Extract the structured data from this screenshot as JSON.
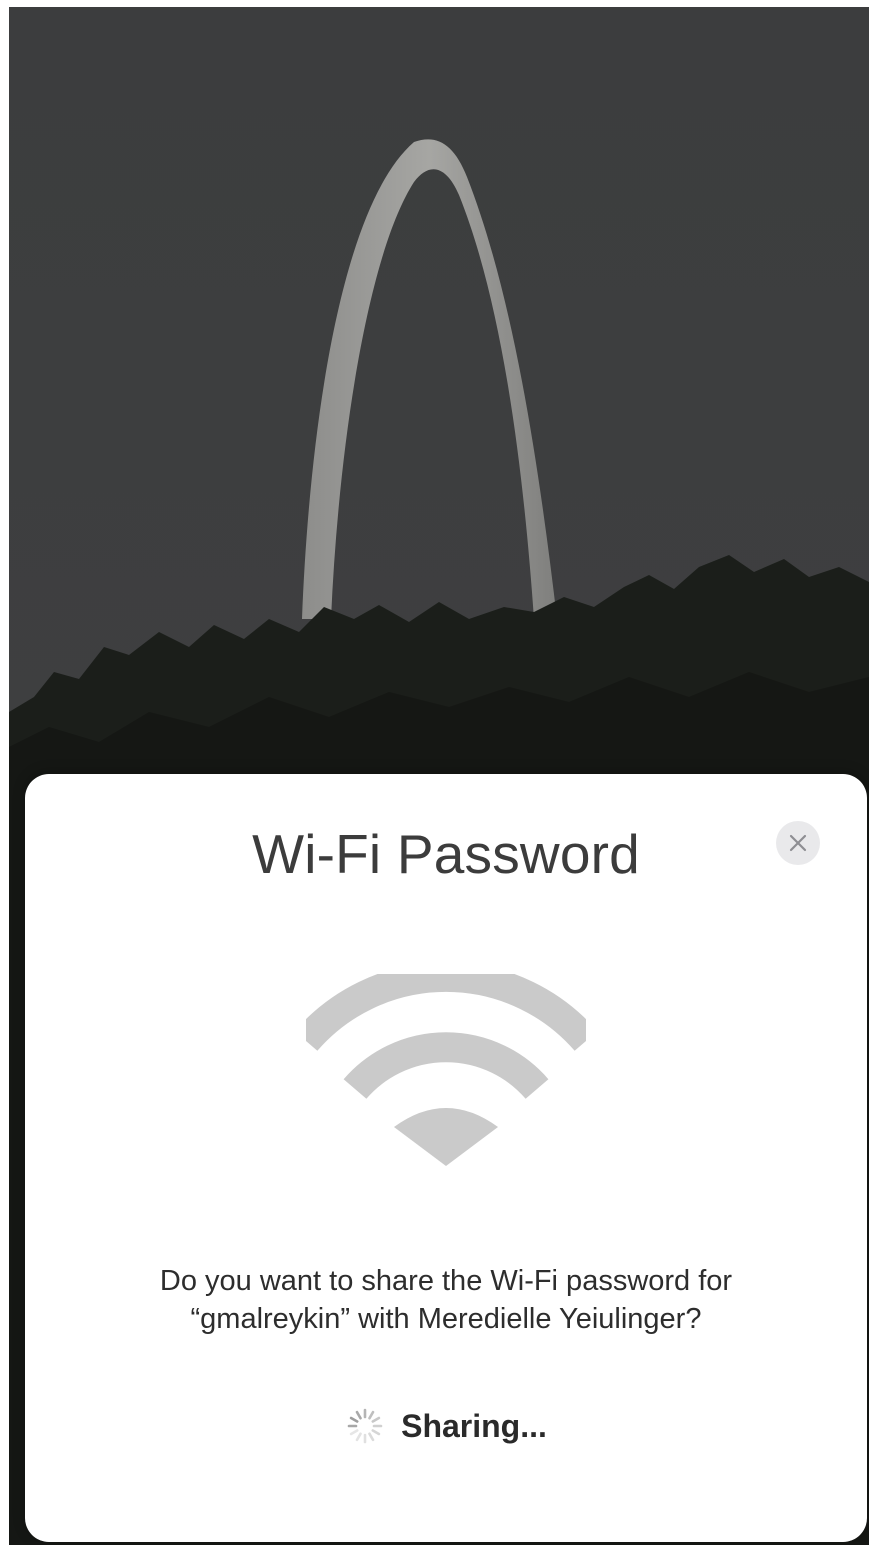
{
  "dialog": {
    "title": "Wi-Fi Password",
    "message_line1": "Do you want to share the Wi-Fi password for",
    "message_line2": "“gmalreykin” with Meredielle Yeiulinger?",
    "status_label": "Sharing...",
    "close_icon": "close-icon",
    "wifi_icon": "wifi-icon",
    "spinner_icon": "activity-spinner-icon"
  },
  "colors": {
    "sheet_background": "#ffffff",
    "title_text": "#3c3c3c",
    "icon_gray": "#cacaca",
    "close_button_bg": "#e9e9eb",
    "wallpaper_sky": "#3a3b3c"
  }
}
